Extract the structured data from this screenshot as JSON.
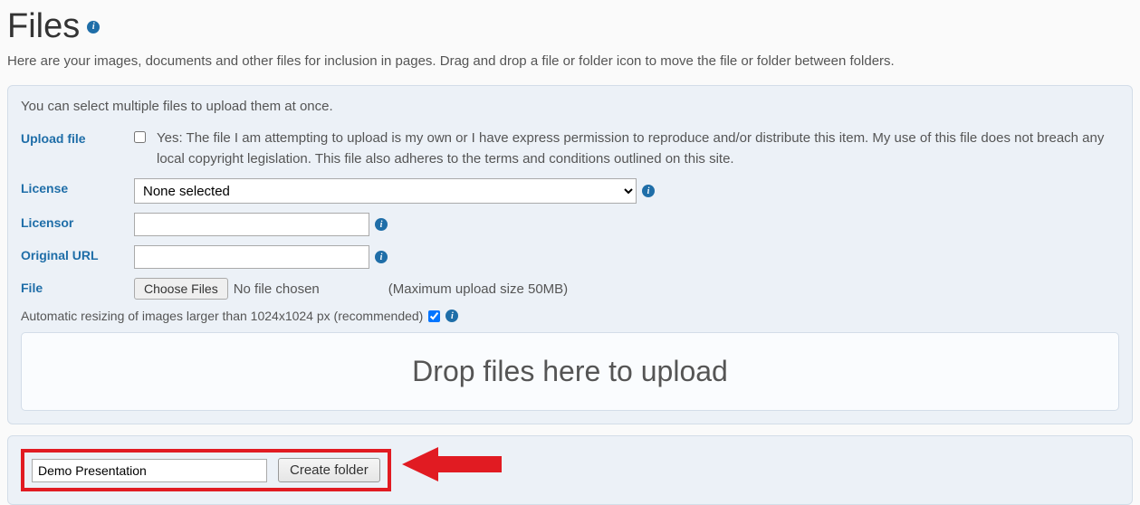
{
  "page": {
    "title": "Files",
    "description": "Here are your images, documents and other files for inclusion in pages. Drag and drop a file or folder icon to move the file or folder between folders."
  },
  "uploadPanel": {
    "intro": "You can select multiple files to upload them at once.",
    "labels": {
      "uploadFile": "Upload file",
      "license": "License",
      "licensor": "Licensor",
      "originalUrl": "Original URL",
      "file": "File"
    },
    "uploadAgreement": "Yes: The file I am attempting to upload is my own or I have express permission to reproduce and/or distribute this item. My use of this file does not breach any local copyright legislation. This file also adheres to the terms and conditions outlined on this site.",
    "licenseSelected": "None selected",
    "licensorValue": "",
    "originalUrlValue": "",
    "chooseFilesLabel": "Choose Files",
    "fileStatus": "No file chosen",
    "maxSize": "(Maximum upload size 50MB)",
    "resizeLabel": "Automatic resizing of images larger than 1024x1024 px (recommended)",
    "dropZone": "Drop files here to upload"
  },
  "createFolder": {
    "inputValue": "Demo Presentation",
    "buttonLabel": "Create folder"
  }
}
